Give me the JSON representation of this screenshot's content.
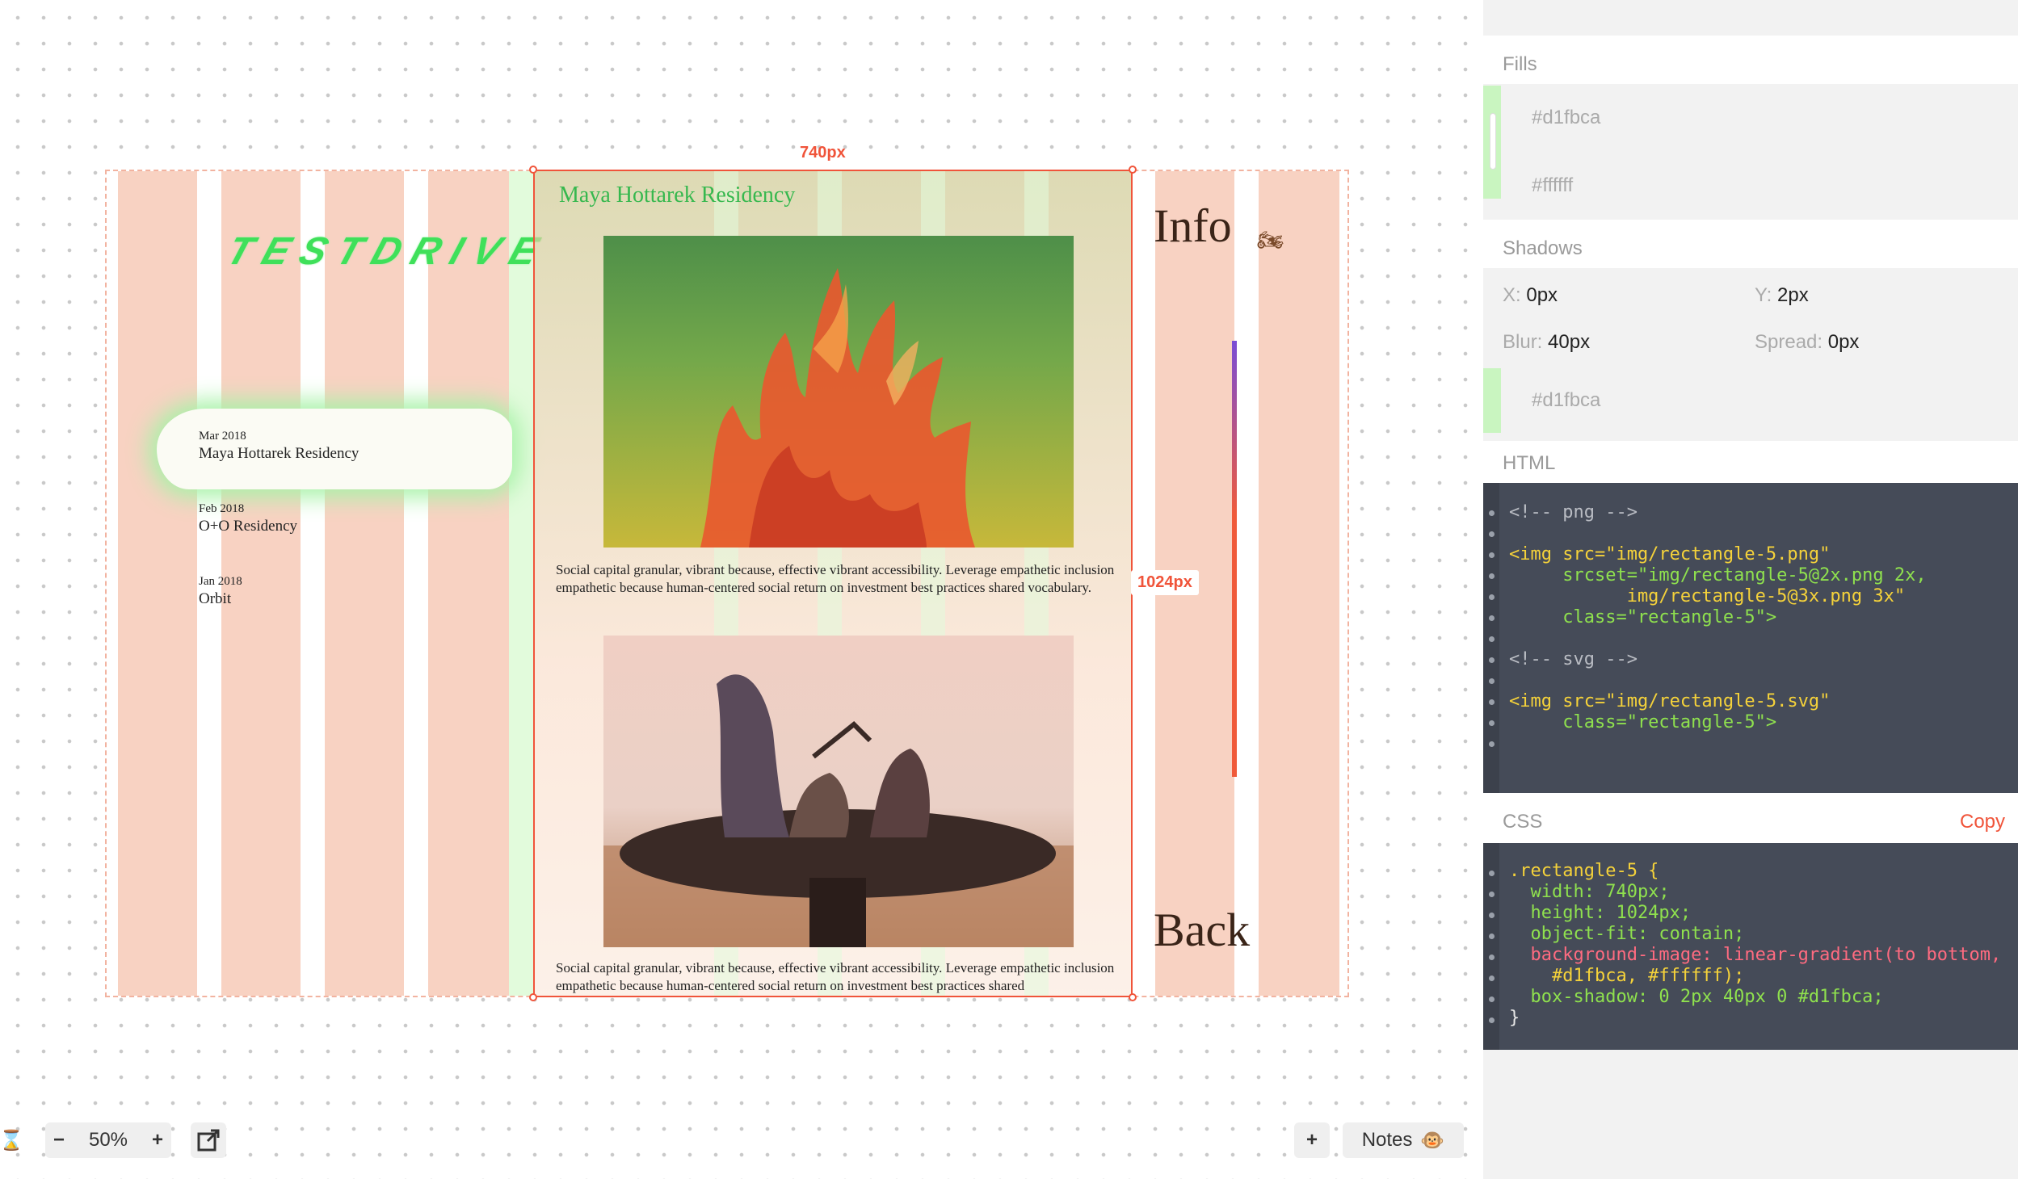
{
  "canvas": {
    "logo_text": "TESTDRIVE",
    "list": [
      {
        "date": "Mar 2018",
        "name": "Maya Hottarek Residency"
      },
      {
        "date": "Feb 2018",
        "name": "O+O Residency"
      },
      {
        "date": "Jan 2018",
        "name": "Orbit"
      }
    ],
    "panel_title": "Maya Hottarek Residency",
    "paragraph_1": "Social capital granular, vibrant because, effective vibrant accessibility. Leverage empathetic inclusion empathetic because human-centered social return on investment best practices shared vocabulary.",
    "paragraph_2": "Social capital granular, vibrant because, effective vibrant accessibility. Leverage empathetic inclusion empathetic because human-centered social return on investment best practices shared",
    "info_label": "Info",
    "back_label": "Back",
    "moto_icon": "🏍",
    "width_badge": "740px",
    "height_badge": "1024px"
  },
  "toolbar": {
    "hourglass_icon": "⌛",
    "zoom_minus": "−",
    "zoom_value": "50%",
    "zoom_plus": "+",
    "export_icon": "⧉",
    "add_icon": "+",
    "notes_label": "Notes",
    "notes_emoji": "🐵"
  },
  "inspector": {
    "fills_heading": "Fills",
    "fills": [
      "#d1fbca",
      "#ffffff"
    ],
    "shadows_heading": "Shadows",
    "shadow": {
      "x_label": "X:",
      "x_value": "0px",
      "y_label": "Y:",
      "y_value": "2px",
      "blur_label": "Blur:",
      "blur_value": "40px",
      "spread_label": "Spread:",
      "spread_value": "0px",
      "color": "#d1fbca"
    },
    "html_heading": "HTML",
    "html_lines": [
      "<!-- png -->",
      "",
      "<img src=\"img/rectangle-5.png\"",
      "     srcset=\"img/rectangle-5@2x.png 2x,",
      "           img/rectangle-5@3x.png 3x\"",
      "     class=\"rectangle-5\">",
      "",
      "<!-- svg -->",
      "",
      "<img src=\"img/rectangle-5.svg\"",
      "     class=\"rectangle-5\">"
    ],
    "css_heading": "CSS",
    "copy_label": "Copy",
    "css_lines": [
      ".rectangle-5 {",
      "  width: 740px;",
      "  height: 1024px;",
      "  object-fit: contain;",
      "  background-image: linear-gradient(to bottom,",
      "    #d1fbca, #ffffff);",
      "  box-shadow: 0 2px 40px 0 #d1fbca;",
      "}"
    ]
  },
  "colors": {
    "accent": "#f0543a",
    "salmon_column": "#f8d2c2",
    "green_fill": "#d1fbca",
    "code_bg": "#454b58"
  }
}
